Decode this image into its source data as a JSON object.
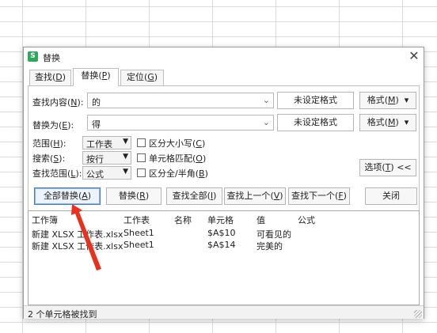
{
  "dialog": {
    "title": "替换",
    "app_icon": "S",
    "close_glyph": "✕",
    "tabs": [
      {
        "label": "查找",
        "key": "(D)",
        "key_open": "(",
        "key_letter": "D",
        "key_close": ")",
        "active": false
      },
      {
        "label": "替换",
        "key_open": "(",
        "key_letter": "P",
        "key_close": ")",
        "active": true
      },
      {
        "label": "定位",
        "key_open": "(",
        "key_letter": "G",
        "key_close": ")",
        "active": false
      }
    ]
  },
  "find": {
    "label": "查找内容",
    "key": "N",
    "value": "的",
    "format_status": "未设定格式",
    "format_button": "格式",
    "format_key": "M"
  },
  "replace": {
    "label": "替换为",
    "key": "E",
    "value": "得",
    "format_status": "未设定格式",
    "format_button": "格式",
    "format_key": "M"
  },
  "options": {
    "scope_label": "范围",
    "scope_key": "H",
    "scope_value": "工作表",
    "search_label": "搜索",
    "search_key": "S",
    "search_value": "按行",
    "lookin_label": "查找范围",
    "lookin_key": "L",
    "lookin_value": "公式",
    "match_case": "区分大小写",
    "match_case_key": "C",
    "match_cell": "单元格匹配",
    "match_cell_key": "O",
    "match_width": "区分全/半角",
    "match_width_key": "B",
    "options_button": "选项",
    "options_key": "T",
    "options_suffix": "<<"
  },
  "buttons": {
    "replace_all": "全部替换",
    "replace_all_key": "A",
    "replace": "替换",
    "replace_key": "R",
    "find_all": "查找全部",
    "find_all_key": "I",
    "find_prev": "查找上一个",
    "find_prev_key": "V",
    "find_next": "查找下一个",
    "find_next_key": "F",
    "close": "关闭"
  },
  "results": {
    "columns": [
      "工作簿",
      "工作表",
      "名称",
      "单元格",
      "值",
      "公式"
    ],
    "rows": [
      {
        "workbook": "新建 XLSX 工作表.xlsx",
        "sheet": "Sheet1",
        "name": "",
        "cell": "$A$10",
        "value": "可看见的",
        "formula": ""
      },
      {
        "workbook": "新建 XLSX 工作表.xlsx",
        "sheet": "Sheet1",
        "name": "",
        "cell": "$A$14",
        "value": "完美的",
        "formula": ""
      }
    ]
  },
  "status": "2 个单元格被找到",
  "colors": {
    "arrow": "#e8321f",
    "app_icon": "#2fa85a",
    "primary_border": "#3a7bd5"
  }
}
